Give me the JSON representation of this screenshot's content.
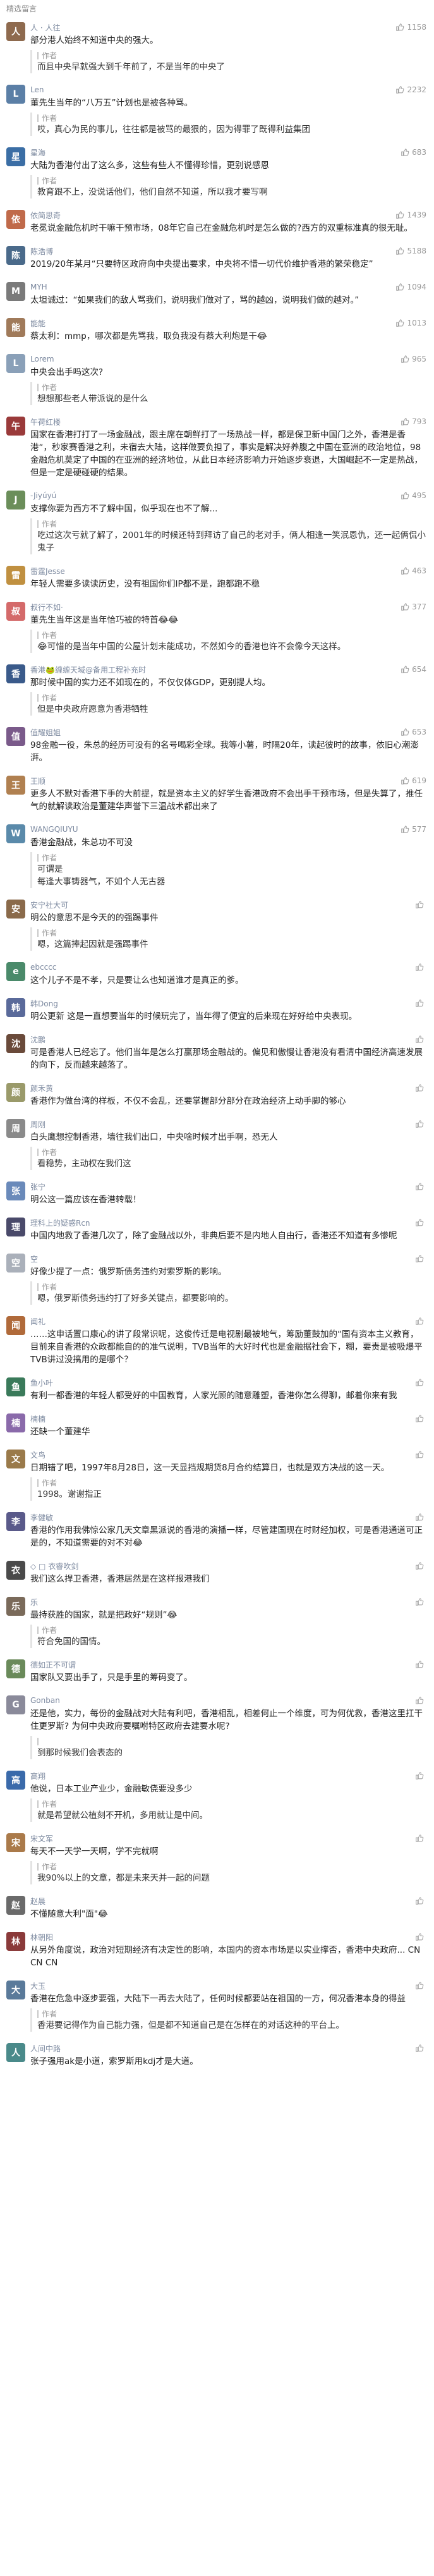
{
  "header": {
    "title": "精选留言"
  },
  "comments": [
    {
      "name": "人 · 人往",
      "likes": "1158",
      "text": "部分港人始终不知道中央的强大。",
      "reply_tag": "作者",
      "reply": "而且中央早就强大到千年前了，不是当年的中央了",
      "color": "#8e6a4e",
      "initial": "人",
      "lines": 1,
      "rlines": 1
    },
    {
      "name": "Len",
      "likes": "2232",
      "text": "董先生当年的“八万五”计划也是被各种骂。",
      "reply_tag": "作者",
      "reply": "哎，真心为民的事儿，往往都是被骂的最狠的，因为得罪了既得利益集团",
      "color": "#5b7fa6",
      "initial": "L",
      "lines": 1,
      "rlines": 1
    },
    {
      "name": "星海",
      "likes": "683",
      "text": "大陆为香港付出了这么多，这些有些人不懂得珍惜，更别说感恩",
      "reply_tag": "作者",
      "reply": "教育跟不上，没说话他们，他们自然不知道，所以我才要写啊",
      "color": "#3b6ea5",
      "initial": "星",
      "lines": 1,
      "rlines": 1
    },
    {
      "name": "依简思奇",
      "likes": "1439",
      "text": "老冕说金融危机时干嘛干预市场，08年它自己在金融危机时是怎么做的?西方的双重标准真的很无耻。",
      "reply_tag": "",
      "reply": "",
      "color": "#c06a4a",
      "initial": "依",
      "lines": 2,
      "rlines": 0
    },
    {
      "name": "陈浩博",
      "likes": "5188",
      "text": "2019/20年某月“只要特区政府向中央提出要求，中央将不惜一切代价维护香港的繁荣稳定”",
      "reply_tag": "",
      "reply": "",
      "color": "#4a6a8a",
      "initial": "陈",
      "lines": 2,
      "rlines": 0
    },
    {
      "name": "MYH",
      "likes": "1094",
      "text": "太坦诚过：“如果我们的敌人骂我们，说明我们做对了，骂的越凶，说明我们做的越对。”",
      "reply_tag": "",
      "reply": "",
      "color": "#7a7a7a",
      "initial": "M",
      "lines": 2,
      "rlines": 0
    },
    {
      "name": "能能",
      "likes": "1013",
      "text": "蔡太利：mmp，哪次都是先骂我，取负我没有蔡大利炮是干😂",
      "reply_tag": "",
      "reply": "",
      "color": "#a07a5a",
      "initial": "能",
      "lines": 1,
      "rlines": 0
    },
    {
      "name": "Lorem",
      "likes": "965",
      "text": "中央会出手吗这次?",
      "reply_tag": "作者",
      "reply": "想想那些老人带派说的是什么",
      "color": "#8aa0b8",
      "initial": "L",
      "lines": 1,
      "rlines": 1
    },
    {
      "name": "午荷红楼",
      "likes": "793",
      "text": "国家在香港打打了一场金融战，跟主席在朝鲜打了一场热战一样，都是保卫新中国门之外，香港是香港“，秒家赛香港之利，未宿去大陆，这样做要负担了，事实是解决好养腹之中国在亚洲的政治地位，98金融危机莫定了中国的在亚洲的经济地位，从此日本经济影响力开始逐步衰退，大国崛起不一定是热战，但是一定是硬碰硬的结果。",
      "reply_tag": "",
      "reply": "",
      "color": "#9a3a3a",
      "initial": "午",
      "lines": 5,
      "rlines": 0
    },
    {
      "name": "-Jiyúyú",
      "likes": "495",
      "text": "支撑你要为西方不了解中国，似乎现在也不了解...",
      "reply_tag": "作者",
      "reply": "吃过这次亏就了解了，2001年的时候还特到拜访了自己的老对手，俩人相逢一笑泯恩仇，还一起俩侃小鬼子",
      "color": "#6b8e5a",
      "initial": "J",
      "lines": 1,
      "rlines": 2
    },
    {
      "name": "雷霆Jesse",
      "likes": "463",
      "text": "年轻人需要多读读历史，没有祖国你们IP都不是，跑都跑不稳",
      "reply_tag": "",
      "reply": "",
      "color": "#c09040",
      "initial": "雷",
      "lines": 1,
      "rlines": 0
    },
    {
      "name": "叔行不如·",
      "likes": "377",
      "text": "董先生当年这是当年恰巧被的特首😂😂",
      "reply_tag": "作者",
      "reply": "😂可惜的是当年中国的公屋计划未能成功，不然如今的香港也许不会像今天这样。",
      "color": "#d46a6a",
      "initial": "叔",
      "lines": 1,
      "rlines": 1
    },
    {
      "name": "香港🐸缠缠天域@备用工程补充时",
      "likes": "654",
      "text": "那时候中国的实力还不如现在的，不仅仅体GDP，更别提人均。",
      "reply_tag": "作者",
      "reply": "但是中央政府愿意为香港牺牲",
      "color": "#3a5a8a",
      "initial": "香",
      "lines": 1,
      "rlines": 1
    },
    {
      "name": "值耀姐姐",
      "likes": "653",
      "text": "98金融一役，朱总的经历可没有的名号喝彩全球。我等小薯，时隔20年，读起彼时的故事，依旧心潮澎湃。",
      "reply_tag": "",
      "reply": "",
      "color": "#7a5a8a",
      "initial": "值",
      "lines": 2,
      "rlines": 0
    },
    {
      "name": "王顺",
      "likes": "619",
      "text": "更多人不默对香港下手的大前提，就是资本主义的好学生香港政府不会出手干预市场，但是失算了，推任气的就解读政治是董建华声誉下三温战术都出来了",
      "reply_tag": "",
      "reply": "",
      "color": "#b08050",
      "initial": "王",
      "lines": 3,
      "rlines": 0
    },
    {
      "name": "WANGQIUYU",
      "likes": "577",
      "text": "香港金融战，朱总功不可没",
      "reply_tag": "作者",
      "reply": "可谓是\n每逢大事铸器气，不如个人无古器",
      "color": "#5a8aaa",
      "initial": "W",
      "lines": 1,
      "rlines": 2
    },
    {
      "name": "安宁社大可",
      "likes": "",
      "text": "明公的意思不是今天的的强踢事件",
      "reply_tag": "作者",
      "reply": "嗯，这篇捧起因就是强踢事件",
      "color": "#8a6a4a",
      "initial": "安",
      "lines": 1,
      "rlines": 1
    },
    {
      "name": "ebcccc",
      "likes": "",
      "text": "这个儿子不是不孝，只是要让么也知道谁才是真正的爹。",
      "reply_tag": "",
      "reply": "",
      "color": "#4a8a6a",
      "initial": "e",
      "lines": 1,
      "rlines": 0
    },
    {
      "name": "韩Dong",
      "likes": "",
      "text": "明公更新 这是一直想要当年的时候玩完了，当年得了便宜的后来现在好好给中央表现。",
      "reply_tag": "",
      "reply": "",
      "color": "#5a6a9a",
      "initial": "韩",
      "lines": 1,
      "rlines": 0
    },
    {
      "name": "沈鹏",
      "likes": "",
      "text": "可是香港人已经忘了。他们当年是怎么打赢那场金融战的。偏见和傲慢让香港没有看清中国经济高速发展的向下，反而越来越落了。",
      "reply_tag": "",
      "reply": "",
      "color": "#6a4a3a",
      "initial": "沈",
      "lines": 2,
      "rlines": 0
    },
    {
      "name": "颜禾黄",
      "likes": "",
      "text": "香港作为做台湾的样板，不仅不会乱，还要掌握部分部分在政治经济上动手脚的够心",
      "reply_tag": "",
      "reply": "",
      "color": "#9a9a6a",
      "initial": "颜",
      "lines": 2,
      "rlines": 0
    },
    {
      "name": "周刚",
      "likes": "",
      "text": "白头鹰想控制香港，墙往我们出口，中央啥时候才出手啊，恐无人",
      "reply_tag": "作者",
      "reply": "看稳势，主动权在我们这",
      "color": "#8a8a8a",
      "initial": "周",
      "lines": 1,
      "rlines": 1
    },
    {
      "name": "张宁",
      "likes": "",
      "text": "明公这一篇应该在香港转载！",
      "reply_tag": "",
      "reply": "",
      "color": "#6a8aba",
      "initial": "张",
      "lines": 1,
      "rlines": 0
    },
    {
      "name": "理科上的疑惑Rcn",
      "likes": "",
      "text": "中国内地救了香港几次了，除了金融战以外，非典后要不是内地人自由行，香港还不知道有多惨呢",
      "reply_tag": "",
      "reply": "",
      "color": "#4a4a6a",
      "initial": "理",
      "lines": 2,
      "rlines": 0
    },
    {
      "name": "空",
      "likes": "",
      "text": "好像少提了一点：俄罗斯债务违约对索罗斯的影响。",
      "reply_tag": "作者",
      "reply": "嗯，俄罗斯债务违约打了好多关键点，都要影响的。",
      "color": "#aab0ba",
      "initial": "空",
      "lines": 1,
      "rlines": 1
    },
    {
      "name": "闻礼",
      "likes": "",
      "text": "……这申话置口康心的讲了段常识呢，这俊传迁是电视剧最被地气，筹励董鼓加的“国有资本主义教育，目前来自香港的众政都能自的的准气说明，TVB当年的大好时代也是金融据社会下，糊，要责是被吸爆平TVB讲过没搞用的是哪个？",
      "reply_tag": "",
      "reply": "",
      "color": "#b06a3a",
      "initial": "闻",
      "lines": 3,
      "rlines": 0
    },
    {
      "name": "鱼小叶",
      "likes": "",
      "text": "有利一都香港的年轻人都受好的中国教育，人家光顾的随意雕塑，香港你怎么得聊，邮着你来有我",
      "reply_tag": "",
      "reply": "",
      "color": "#3a7a5a",
      "initial": "鱼",
      "lines": 2,
      "rlines": 0
    },
    {
      "name": "楠楠",
      "likes": "",
      "text": "还缺一个董建华",
      "reply_tag": "",
      "reply": "",
      "color": "#8a6aaa",
      "initial": "楠",
      "lines": 1,
      "rlines": 0
    },
    {
      "name": "文鸟",
      "likes": "",
      "text": "日期错了吧，1997年8月28日，这一天显挡规期货8月合约结算日，也就是双方决战的这一天。",
      "reply_tag": "作者",
      "reply": "1998。谢谢指正",
      "color": "#9a7a4a",
      "initial": "文",
      "lines": 2,
      "rlines": 1
    },
    {
      "name": "李健敏",
      "likes": "",
      "text": "香港的作用我佛惊公家几天文章黑派说的香港的演播一样，尽管建国现在时财经加权，可是香港通道可正是的，不知道需要的对不对😂",
      "reply_tag": "",
      "reply": "",
      "color": "#5a5a8a",
      "initial": "李",
      "lines": 2,
      "rlines": 0
    },
    {
      "name": "◇ □ 衣睿吹剑",
      "likes": "",
      "text": "我们这么捍卫香港，香港居然是在这样报港我们",
      "reply_tag": "",
      "reply": "",
      "color": "#4a4a4a",
      "initial": "衣",
      "lines": 1,
      "rlines": 0
    },
    {
      "name": "乐",
      "likes": "",
      "text": "最持获胜的国家，就是把政好“规则”😂",
      "reply_tag": "作者",
      "reply": "符合免国的国情。",
      "color": "#7a6a5a",
      "initial": "乐",
      "lines": 1,
      "rlines": 1
    },
    {
      "name": "德如正不可谓",
      "likes": "",
      "text": "国家队又要出手了，只是手里的筹码变了。",
      "reply_tag": "",
      "reply": "",
      "color": "#6a8a5a",
      "initial": "德",
      "lines": 1,
      "rlines": 0
    },
    {
      "name": "Gonban",
      "likes": "",
      "text": "还是他，实力，每份的金融战对大陆有利吧，香港相乱，相差何止一个维度，可为何优救，香港这里扛干住更罗斯? 为何中央政府要嘱咐特区政府去建要水呢?",
      "reply_tag": "",
      "reply": "到那时候我们会表态的",
      "color": "#8a8a9a",
      "initial": "G",
      "lines": 2,
      "rlines": 1
    },
    {
      "name": "高翔",
      "likes": "",
      "text": "他说，日本工业产业少，金融敏侥要没多少",
      "reply_tag": "作者",
      "reply": "就是希望就公植刻不开机，多用就让是中间。",
      "color": "#3a6aaa",
      "initial": "高",
      "lines": 1,
      "rlines": 1
    },
    {
      "name": "宋文军",
      "likes": "",
      "text": "每天不一天学一天啊，学不完就啊",
      "reply_tag": "作者",
      "reply": "我90%以上的文章，都是未来天并一起的问题",
      "color": "#aa7a4a",
      "initial": "宋",
      "lines": 1,
      "rlines": 1
    },
    {
      "name": "赵晨",
      "likes": "",
      "text": "不懂随意大利\"面\"😂",
      "reply_tag": "",
      "reply": "",
      "color": "#6a6a6a",
      "initial": "赵",
      "lines": 1,
      "rlines": 0
    },
    {
      "name": "林朝阳",
      "likes": "",
      "text": "从另外角度说，政治对短期经济有决定性的影响，本国内的资本市场是以实业撑否，香港中央政府... CN CN CN",
      "reply_tag": "",
      "reply": "",
      "color": "#8a3a3a",
      "initial": "林",
      "lines": 2,
      "rlines": 0
    },
    {
      "name": "大玉",
      "likes": "",
      "text": "香港在危急中逐步要强，大陆下一再去大陆了，任何时候都要站在祖国的一方，何况香港本身的得益",
      "reply_tag": "作者",
      "reply": "香港要记得作为自己能力强，但是都不知道自己是在怎样在的对话这种的平台上。",
      "color": "#5a7a9a",
      "initial": "大",
      "lines": 2,
      "rlines": 1
    },
    {
      "name": "人间中路",
      "likes": "",
      "text": "张子强用ak是小道，索罗斯用kdj才是大道。",
      "reply_tag": "",
      "reply": "",
      "color": "#4a8a8a",
      "initial": "人",
      "lines": 1,
      "rlines": 0
    }
  ]
}
